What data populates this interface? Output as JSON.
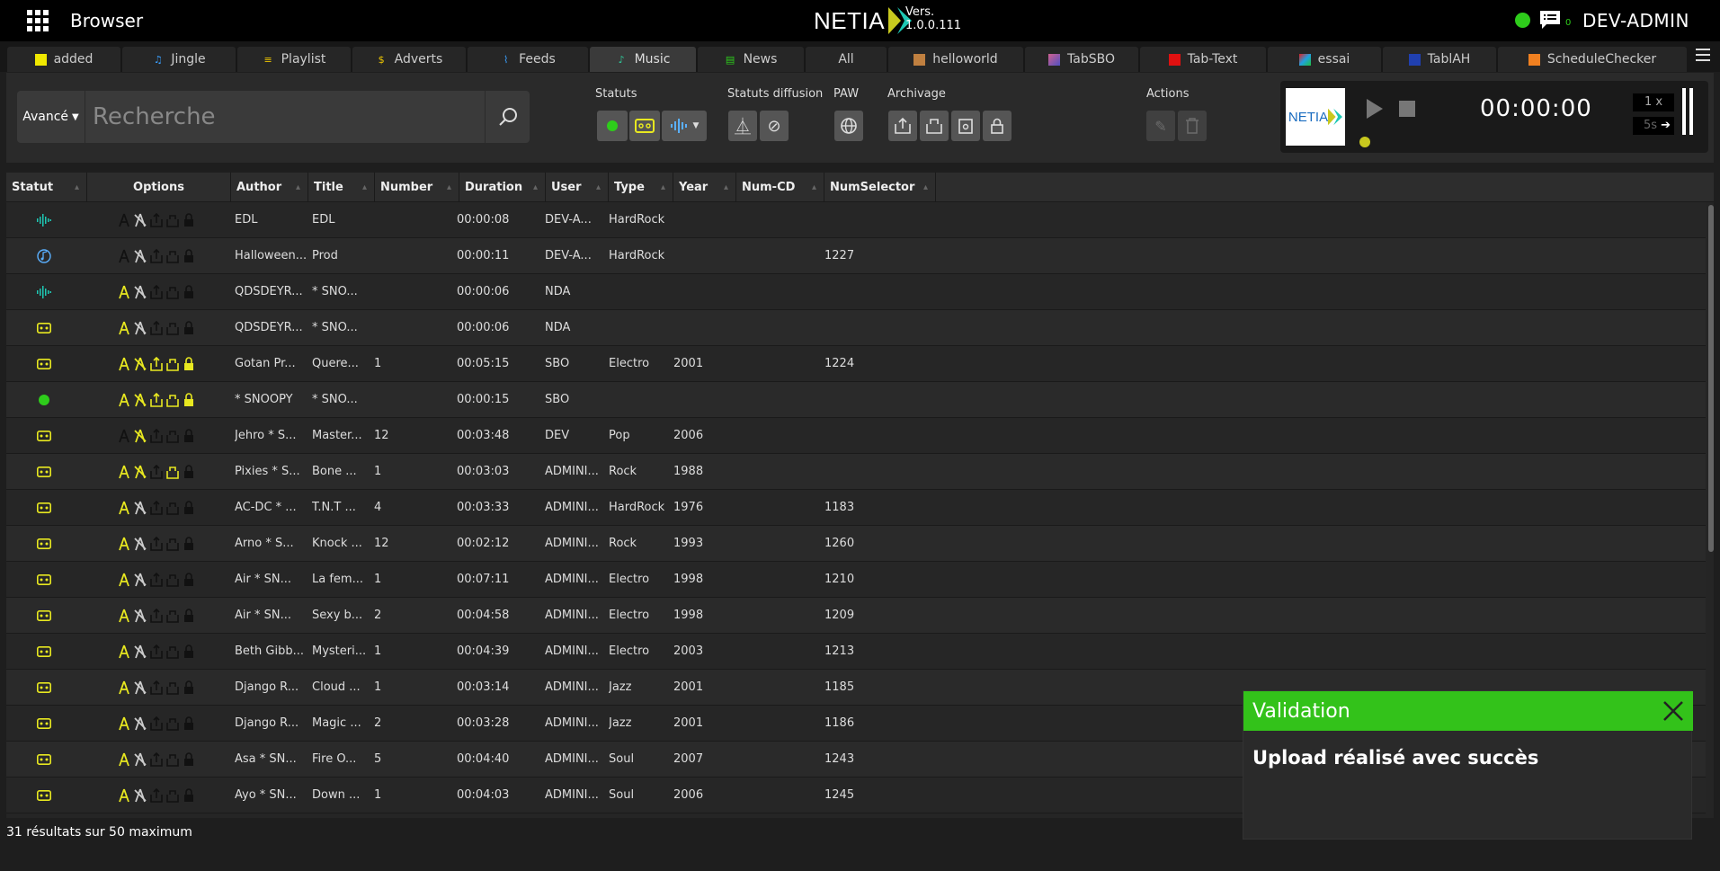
{
  "app": {
    "title": "Browser",
    "logo_text": "NETIA",
    "version_label": "Vers.",
    "version": "1.0.0.111",
    "messages_count": "0",
    "user": "DEV-ADMIN"
  },
  "tabs": [
    {
      "label": "added",
      "icon": "yellow-square-icon"
    },
    {
      "label": "Jingle",
      "icon": "bell-icon"
    },
    {
      "label": "Playlist",
      "icon": "list-icon"
    },
    {
      "label": "Adverts",
      "icon": "dollar-icon"
    },
    {
      "label": "Feeds",
      "icon": "rss-icon"
    },
    {
      "label": "Music",
      "icon": "music-note-icon",
      "active": true
    },
    {
      "label": "News",
      "icon": "news-icon"
    },
    {
      "label": "All",
      "icon": ""
    },
    {
      "label": "helloworld",
      "icon": "image-icon"
    },
    {
      "label": "TabSBO",
      "icon": "image-icon"
    },
    {
      "label": "Tab-Text",
      "icon": "red-square-icon"
    },
    {
      "label": "essai",
      "icon": "colorful-logo-icon"
    },
    {
      "label": "TablAH",
      "icon": "flag-icon"
    },
    {
      "label": "ScheduleChecker",
      "icon": "orange-square-icon"
    }
  ],
  "search": {
    "mode": "Avancé",
    "placeholder": "Recherche"
  },
  "toolbar": {
    "statuts_label": "Statuts",
    "diffusion_label": "Statuts diffusion",
    "paw_label": "PAW",
    "archivage_label": "Archivage",
    "actions_label": "Actions"
  },
  "player": {
    "time": "00:00:00",
    "speed": "1 x",
    "skip": "5s"
  },
  "columns": [
    "Statut",
    "Options",
    "Author",
    "Title",
    "Number",
    "Duration",
    "User",
    "Type",
    "Year",
    "Num-CD",
    "NumSelector"
  ],
  "rows": [
    {
      "status": "waveform",
      "opts": "gray",
      "author": "EDL",
      "title": "EDL",
      "number": "",
      "duration": "00:00:08",
      "user": "DEV-A...",
      "type": "HardRock",
      "year": "",
      "numcd": "",
      "numsel": ""
    },
    {
      "status": "music",
      "opts": "gray",
      "author": "Halloween...",
      "title": "Prod",
      "number": "",
      "duration": "00:00:11",
      "user": "DEV-A...",
      "type": "HardRock",
      "year": "",
      "numcd": "",
      "numsel": "1227"
    },
    {
      "status": "waveform",
      "opts": "y1",
      "author": "QDSDEYR...",
      "title": "* SNO...",
      "number": "",
      "duration": "00:00:06",
      "user": "NDA",
      "type": "",
      "year": "",
      "numcd": "",
      "numsel": ""
    },
    {
      "status": "tape",
      "opts": "y1",
      "author": "QDSDEYR...",
      "title": "* SNO...",
      "number": "",
      "duration": "00:00:06",
      "user": "NDA",
      "type": "",
      "year": "",
      "numcd": "",
      "numsel": ""
    },
    {
      "status": "tape",
      "opts": "yall",
      "author": "Gotan Pr...",
      "title": "Quere...",
      "number": "1",
      "duration": "00:05:15",
      "user": "SBO",
      "type": "Electro",
      "year": "2001",
      "numcd": "",
      "numsel": "1224"
    },
    {
      "status": "dot",
      "opts": "yall",
      "author": "* SNOOPY",
      "title": "* SNO...",
      "number": "",
      "duration": "00:00:15",
      "user": "SBO",
      "type": "",
      "year": "",
      "numcd": "",
      "numsel": ""
    },
    {
      "status": "tape",
      "opts": "y2",
      "author": "Jehro * S...",
      "title": "Master...",
      "number": "12",
      "duration": "00:03:48",
      "user": "DEV",
      "type": "Pop",
      "year": "2006",
      "numcd": "",
      "numsel": ""
    },
    {
      "status": "tape",
      "opts": "y124",
      "author": "Pixies * S...",
      "title": "Bone ...",
      "number": "1",
      "duration": "00:03:03",
      "user": "ADMINI...",
      "type": "Rock",
      "year": "1988",
      "numcd": "",
      "numsel": ""
    },
    {
      "status": "tape",
      "opts": "y1",
      "author": "AC-DC * ...",
      "title": "T.N.T ...",
      "number": "4",
      "duration": "00:03:33",
      "user": "ADMINI...",
      "type": "HardRock",
      "year": "1976",
      "numcd": "",
      "numsel": "1183"
    },
    {
      "status": "tape",
      "opts": "y1",
      "author": "Arno * S...",
      "title": "Knock ...",
      "number": "12",
      "duration": "00:02:12",
      "user": "ADMINI...",
      "type": "Rock",
      "year": "1993",
      "numcd": "",
      "numsel": "1260"
    },
    {
      "status": "tape",
      "opts": "y1",
      "author": "Air * SN...",
      "title": "La fem...",
      "number": "1",
      "duration": "00:07:11",
      "user": "ADMINI...",
      "type": "Electro",
      "year": "1998",
      "numcd": "",
      "numsel": "1210"
    },
    {
      "status": "tape",
      "opts": "y1",
      "author": "Air * SN...",
      "title": "Sexy b...",
      "number": "2",
      "duration": "00:04:58",
      "user": "ADMINI...",
      "type": "Electro",
      "year": "1998",
      "numcd": "",
      "numsel": "1209"
    },
    {
      "status": "tape",
      "opts": "y1",
      "author": "Beth Gibb...",
      "title": "Mysteri...",
      "number": "1",
      "duration": "00:04:39",
      "user": "ADMINI...",
      "type": "Electro",
      "year": "2003",
      "numcd": "",
      "numsel": "1213"
    },
    {
      "status": "tape",
      "opts": "y1",
      "author": "Django R...",
      "title": "Cloud ...",
      "number": "1",
      "duration": "00:03:14",
      "user": "ADMINI...",
      "type": "Jazz",
      "year": "2001",
      "numcd": "",
      "numsel": "1185"
    },
    {
      "status": "tape",
      "opts": "y1",
      "author": "Django R...",
      "title": "Magic ...",
      "number": "2",
      "duration": "00:03:28",
      "user": "ADMINI...",
      "type": "Jazz",
      "year": "2001",
      "numcd": "",
      "numsel": "1186"
    },
    {
      "status": "tape",
      "opts": "y1",
      "author": "Asa * SN...",
      "title": "Fire O...",
      "number": "5",
      "duration": "00:04:40",
      "user": "ADMINI...",
      "type": "Soul",
      "year": "2007",
      "numcd": "",
      "numsel": "1243"
    },
    {
      "status": "tape",
      "opts": "y1",
      "author": "Ayo * SN...",
      "title": "Down ...",
      "number": "1",
      "duration": "00:04:03",
      "user": "ADMINI...",
      "type": "Soul",
      "year": "2006",
      "numcd": "",
      "numsel": "1245"
    }
  ],
  "footer": {
    "results": "31 résultats sur 50 maximum"
  },
  "toast": {
    "title": "Validation",
    "message": "Upload réalisé avec succès"
  },
  "colors": {
    "accent_yellow": "#c8c81e",
    "success_green": "#33c21a",
    "status_teal": "#1ec8b4",
    "status_green": "#2ecc1b"
  }
}
